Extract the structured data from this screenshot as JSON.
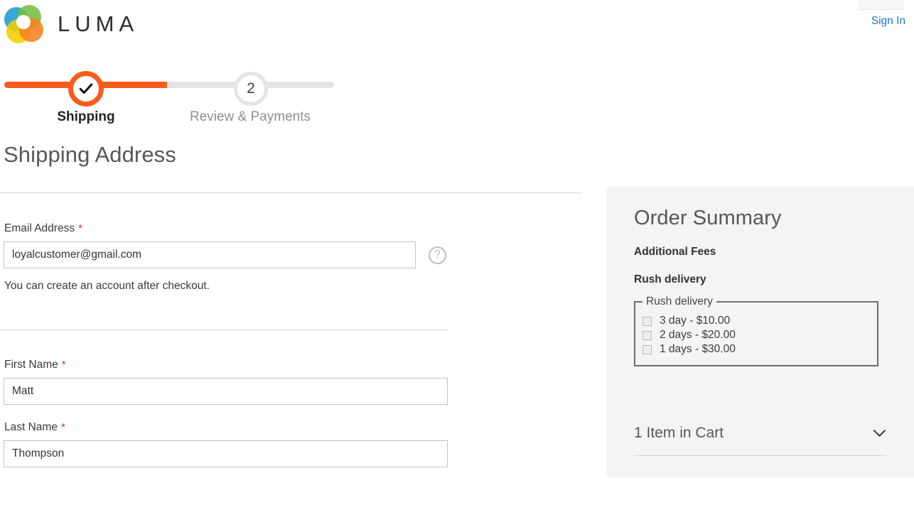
{
  "header": {
    "brand": "LUMA",
    "brand_icon": "luma-logo-icon",
    "signin_label": "Sign In"
  },
  "progress": {
    "steps": [
      {
        "label": "Shipping",
        "marker": "check-icon",
        "state": "completed"
      },
      {
        "label": "Review & Payments",
        "marker": "2",
        "state": "upcoming"
      }
    ],
    "accent_color": "#f85c1c",
    "track_color": "#e4e4e4"
  },
  "shipping": {
    "title": "Shipping Address",
    "email": {
      "label": "Email Address",
      "required_marker": "*",
      "value": "loyalcustomer@gmail.com",
      "placeholder": "Email Address",
      "tooltip_icon": "help-question-icon",
      "note": "You can create an account after checkout."
    },
    "first_name": {
      "label": "First Name",
      "required_marker": "*",
      "value": "Matt",
      "placeholder": "First Name"
    },
    "last_name": {
      "label": "Last Name",
      "required_marker": "*",
      "value": "Thompson",
      "placeholder": "Last Name"
    }
  },
  "order_summary": {
    "title": "Order Summary",
    "additional_fees_heading": "Additional Fees",
    "rush_delivery_heading": "Rush delivery",
    "rush_fieldset_legend": "Rush delivery",
    "rush_options": [
      {
        "label": "3 day - $10.00",
        "checked": false
      },
      {
        "label": "2 days - $20.00",
        "checked": false
      },
      {
        "label": "1 days - $30.00",
        "checked": false
      }
    ],
    "cart_toggle_label": "1 Item in Cart",
    "cart_toggle_icon": "chevron-down-icon",
    "panel_color": "#f4f4f4"
  }
}
